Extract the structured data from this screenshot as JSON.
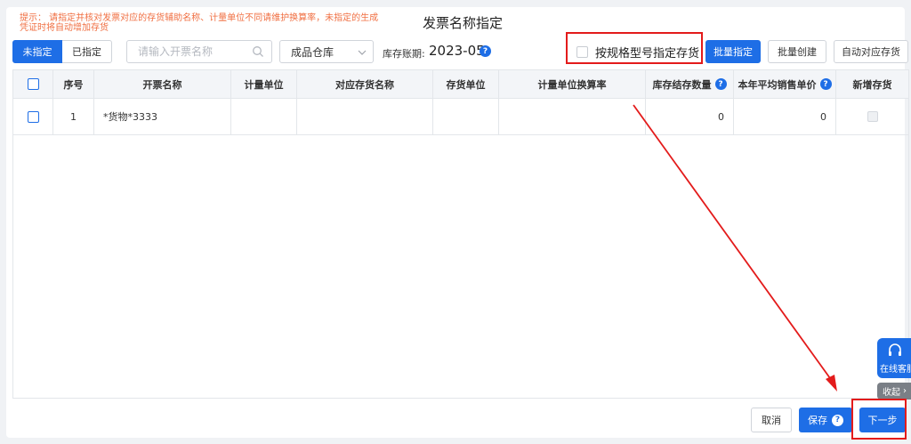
{
  "hint": "提示：  请指定并核对发票对应的存货辅助名称、计量单位不同请维护换算率，未指定的生成凭证时将自动增加存货",
  "title": "发票名称指定",
  "toolbar": {
    "tab_active": "未指定",
    "tab_other": "已指定",
    "search_placeholder": "请输入开票名称",
    "warehouse": "成品仓库",
    "period_label": "库存账期:",
    "period_value": "2023-05",
    "spec_checkbox": "按规格型号指定存货",
    "btn_batch_assign": "批量指定",
    "btn_batch_create": "批量创建",
    "btn_auto": "自动对应存货"
  },
  "table": {
    "headers": {
      "seq": "序号",
      "invoice_name": "开票名称",
      "unit": "计量单位",
      "stock_name": "对应存货名称",
      "stock_unit": "存货单位",
      "rate": "计量单位换算率",
      "qty": "库存结存数量",
      "avg_price": "本年平均销售单价",
      "new_stock": "新增存货"
    },
    "rows": [
      {
        "seq": "1",
        "invoice_name": "*货物*3333",
        "unit": "",
        "stock_name": "",
        "stock_unit": "",
        "rate": "",
        "qty": "0",
        "avg_price": "0"
      }
    ]
  },
  "side": {
    "service": "在线客服",
    "collapse": "收起"
  },
  "footer": {
    "cancel": "取消",
    "save": "保存",
    "next": "下一步"
  },
  "colors": {
    "primary": "#1e6ee6",
    "annotation_red": "#e31b1b",
    "hint_orange": "#f06f42"
  }
}
